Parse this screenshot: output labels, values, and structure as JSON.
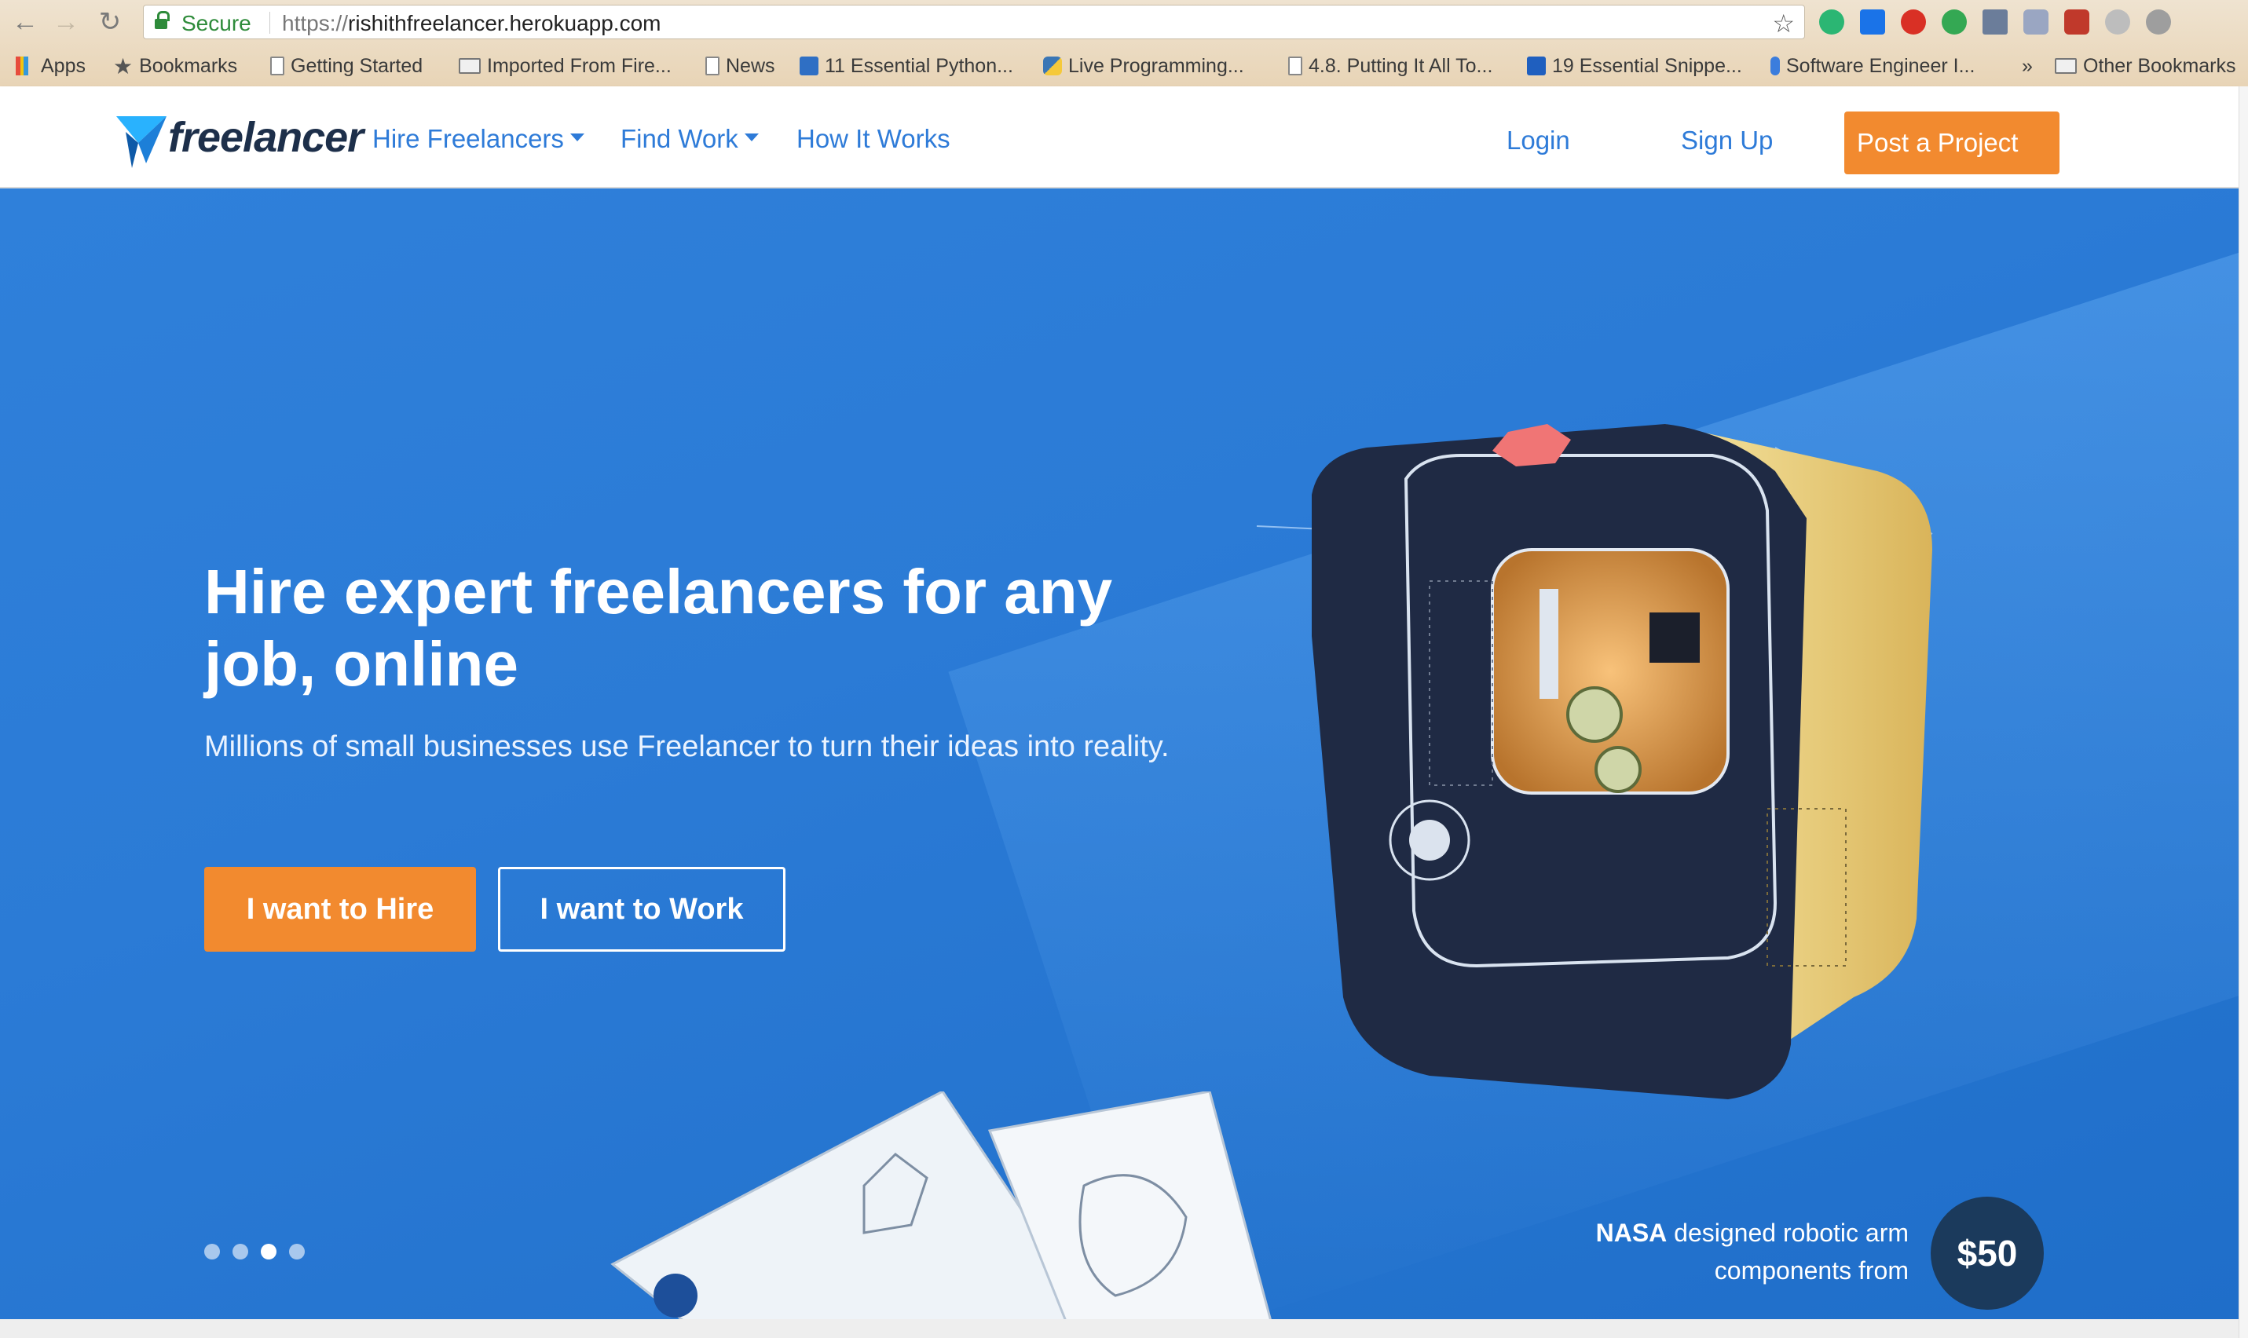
{
  "browser": {
    "secure_label": "Secure",
    "url_scheme": "https://",
    "url_host": "rishithfreelancer.herokuapp.com",
    "bookmarks": [
      {
        "label": "Apps",
        "icon": "apps-grid-icon"
      },
      {
        "label": "Bookmarks",
        "icon": "star-icon"
      },
      {
        "label": "Getting Started",
        "icon": "page-icon"
      },
      {
        "label": "Imported From Fire...",
        "icon": "folder-icon"
      },
      {
        "label": "News",
        "icon": "page-icon"
      },
      {
        "label": "11 Essential Python...",
        "icon": "site-icon"
      },
      {
        "label": "Live Programming...",
        "icon": "python-icon"
      },
      {
        "label": "4.8. Putting It All To...",
        "icon": "page-icon"
      },
      {
        "label": "19 Essential Snippe...",
        "icon": "site-icon"
      },
      {
        "label": "Software Engineer I...",
        "icon": "site-icon"
      },
      {
        "label": "Other Bookmarks",
        "icon": "folder-icon"
      }
    ],
    "overflow_label": "»"
  },
  "header": {
    "logo_text": "freelancer",
    "nav": {
      "hire": "Hire Freelancers",
      "find": "Find Work",
      "how": "How It Works"
    },
    "login": "Login",
    "signup": "Sign Up",
    "post_project": "Post a Project"
  },
  "hero": {
    "headline": "Hire expert freelancers for any job, online",
    "subtext": "Millions of small businesses use Freelancer to turn their ideas into reality.",
    "hire_button": "I want to Hire",
    "work_button": "I want to Work",
    "carousel_active_index": 2,
    "carousel_count": 4,
    "caption_bold": "NASA",
    "caption_rest": "designed robotic arm components from",
    "price": "$50"
  },
  "colors": {
    "brand_blue": "#2e7bd8",
    "accent_orange": "#f28a2f",
    "hero_blue": "#2b7bd6",
    "price_bubble": "#1b3a5c"
  }
}
